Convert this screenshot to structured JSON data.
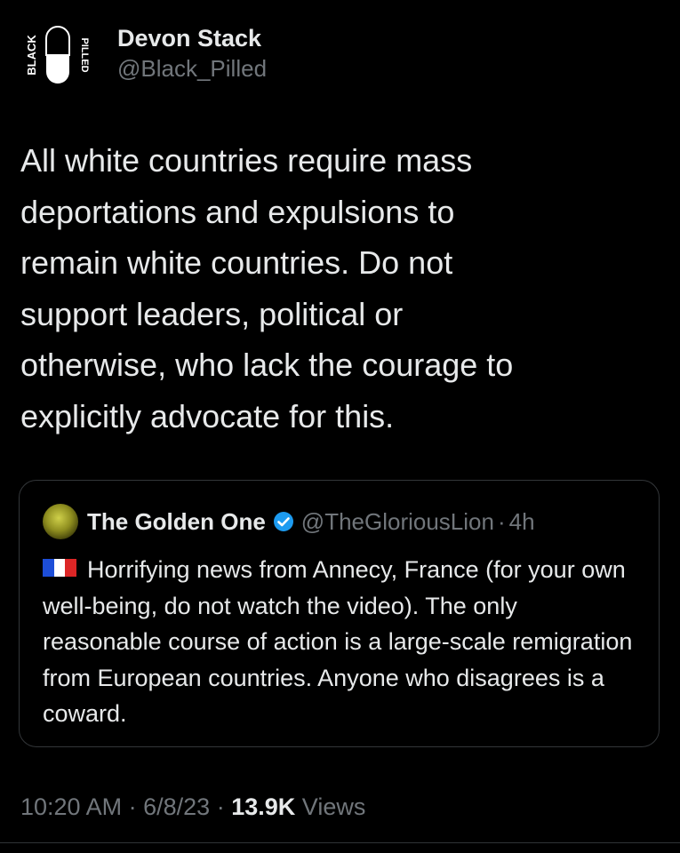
{
  "author": {
    "name": "Devon Stack",
    "handle": "@Black_Pilled",
    "avatar_text_left": "BLACK",
    "avatar_text_right": "PILLED"
  },
  "tweet": {
    "text": "All white countries require mass\ndeportations and expulsions to\nremain white countries. Do not\nsupport leaders, political or\notherwise, who lack the courage to\nexplicitly advocate for this."
  },
  "quote": {
    "name": "The Golden One",
    "handle": "@TheGloriousLion",
    "separator": "·",
    "time": "4h",
    "flag_colors": [
      "#1d4ed8",
      "#ffffff",
      "#dc2626"
    ],
    "text": "Horrifying news from Annecy, France (for your own well-being, do not watch the video). The only reasonable course of action is a large-scale remigration from European countries. Anyone who disagrees is a coward."
  },
  "meta": {
    "time": "10:20 AM",
    "sep1": "·",
    "date": "6/8/23",
    "sep2": "·",
    "views_count": "13.9K",
    "views_label": "Views"
  },
  "colors": {
    "background": "#000000",
    "text": "#e7e9ea",
    "muted": "#71767b",
    "border": "#333639",
    "verified": "#1d9bf0"
  }
}
